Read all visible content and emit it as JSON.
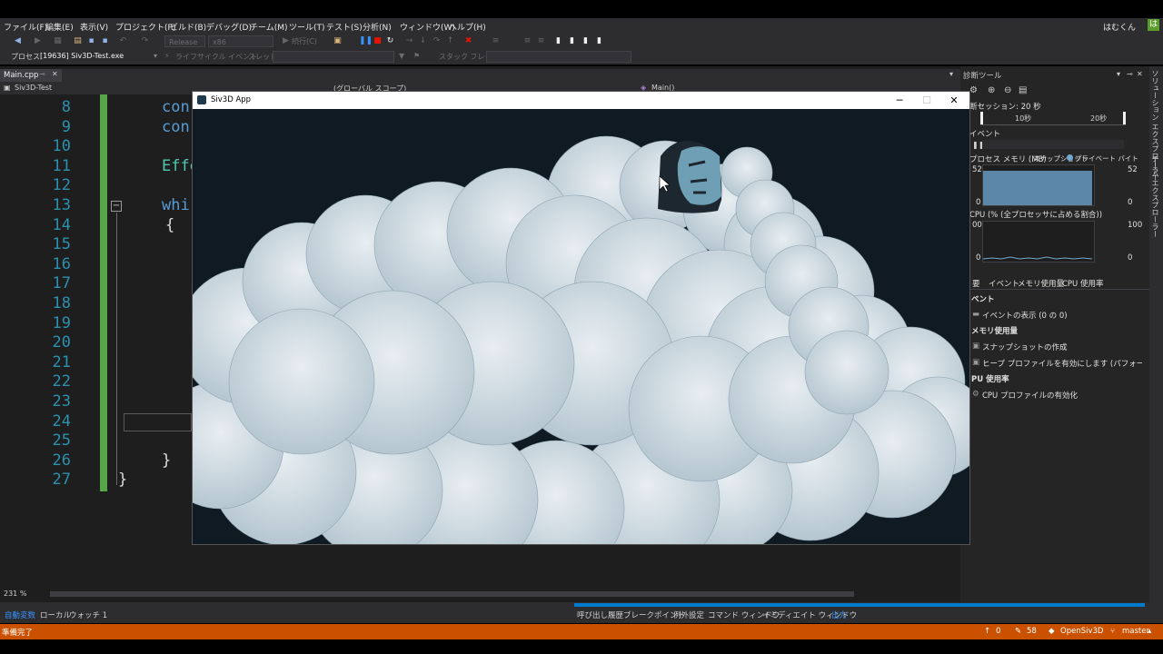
{
  "menubar": {
    "items": [
      "ファイル(F)",
      "編集(E)",
      "表示(V)",
      "プロジェクト(P)",
      "ビルド(B)",
      "デバッグ(D)",
      "チーム(M)",
      "ツール(T)",
      "テスト(S)",
      "分析(N)",
      "ウィンドウ(W)",
      "ヘルプ(H)"
    ],
    "user_name": "はむくん",
    "user_badge": "は"
  },
  "toolbar": {
    "configuration": "Release",
    "platform": "x86",
    "continue_label": "続行(C)"
  },
  "process_bar": {
    "process_label": "プロセス",
    "process_value": "[19636] Siv3D-Test.exe",
    "lifecycle_label": "ライフサイクル イベント",
    "thread_label": "スレッド",
    "stackframe_label": "スタック フレーム"
  },
  "editor": {
    "tab_name": "Main.cpp",
    "project_name": "Siv3D-Test",
    "scope": "(グローバル スコープ)",
    "function": "Main()",
    "zoom": "231 %",
    "lines": [
      {
        "n": "8",
        "code": "con",
        "color": "#569cd6"
      },
      {
        "n": "9",
        "code": "con",
        "color": "#569cd6"
      },
      {
        "n": "10",
        "code": "",
        "color": "#dcdcdc"
      },
      {
        "n": "11",
        "code": "Effe",
        "color": "#4ec9b0"
      },
      {
        "n": "12",
        "code": "",
        "color": "#dcdcdc"
      },
      {
        "n": "13",
        "code": "whi",
        "color": "#569cd6"
      },
      {
        "n": "14",
        "code": "{",
        "color": "#dcdcdc"
      },
      {
        "n": "15",
        "code": "",
        "color": "#dcdcdc"
      },
      {
        "n": "16",
        "code": "",
        "color": "#dcdcdc"
      },
      {
        "n": "17",
        "code": "",
        "color": "#dcdcdc"
      },
      {
        "n": "18",
        "code": "",
        "color": "#dcdcdc"
      },
      {
        "n": "19",
        "code": "",
        "color": "#dcdcdc"
      },
      {
        "n": "20",
        "code": "",
        "color": "#dcdcdc"
      },
      {
        "n": "21",
        "code": "",
        "color": "#dcdcdc"
      },
      {
        "n": "22",
        "code": "",
        "color": "#dcdcdc"
      },
      {
        "n": "23",
        "code": "",
        "color": "#dcdcdc"
      },
      {
        "n": "24",
        "code": "",
        "color": "#dcdcdc"
      },
      {
        "n": "25",
        "code": "",
        "color": "#dcdcdc"
      },
      {
        "n": "26",
        "code": "}",
        "color": "#dcdcdc"
      },
      {
        "n": "27",
        "code": "}",
        "color": "#dcdcdc"
      }
    ]
  },
  "app_window": {
    "title": "Siv3D App",
    "minimize": "─",
    "maximize": "☐",
    "close": "✕"
  },
  "diagnostics": {
    "title": "診断ツール",
    "session": "断セッション: 20 秒",
    "tick_10": "10秒",
    "tick_20": "20秒",
    "events_header": "イベント",
    "memory_header": "プロセス メモリ (MB)",
    "memory_legend_snapshot": "スナップショット",
    "memory_legend_private": "プライベート バイト",
    "memory_max": "52",
    "memory_min": "0",
    "cpu_header": "CPU (% (全プロセッサに占める割合))",
    "cpu_max": "100",
    "cpu_max_left": "00",
    "cpu_min": "0",
    "tabs": [
      "要",
      "イベント",
      "メモリ使用量",
      "CPU 使用率"
    ],
    "sections": [
      {
        "header": "ベント",
        "item": "イベントの表示 (0 の 0)"
      },
      {
        "header": "メモリ使用量",
        "item": "スナップショットの作成",
        "item2": "ヒープ プロファイルを有効にします (パフォーマンスに影響し"
      },
      {
        "header": "PU 使用率",
        "item": "CPU プロファイルの有効化"
      }
    ]
  },
  "right_strip": {
    "solution_explorer": "ソリューション エクスプローラー",
    "team_explorer": "チーム エクスプローラー"
  },
  "bottom_tabs": {
    "left": [
      "自動変数",
      "ローカル",
      "ウォッチ 1"
    ],
    "right": [
      "呼び出し履歴",
      "ブレークポイント",
      "例外設定",
      "コマンド ウィンドウ",
      "イミディエイト ウィンドウ",
      "出力"
    ]
  },
  "statusbar": {
    "left": "準備完了",
    "errors": "0",
    "changes": "58",
    "repo": "OpenSiv3D",
    "branch": "master"
  },
  "colors": {
    "accent": "#007acc",
    "status": "#ca5100",
    "change_bar": "#57a64a"
  }
}
